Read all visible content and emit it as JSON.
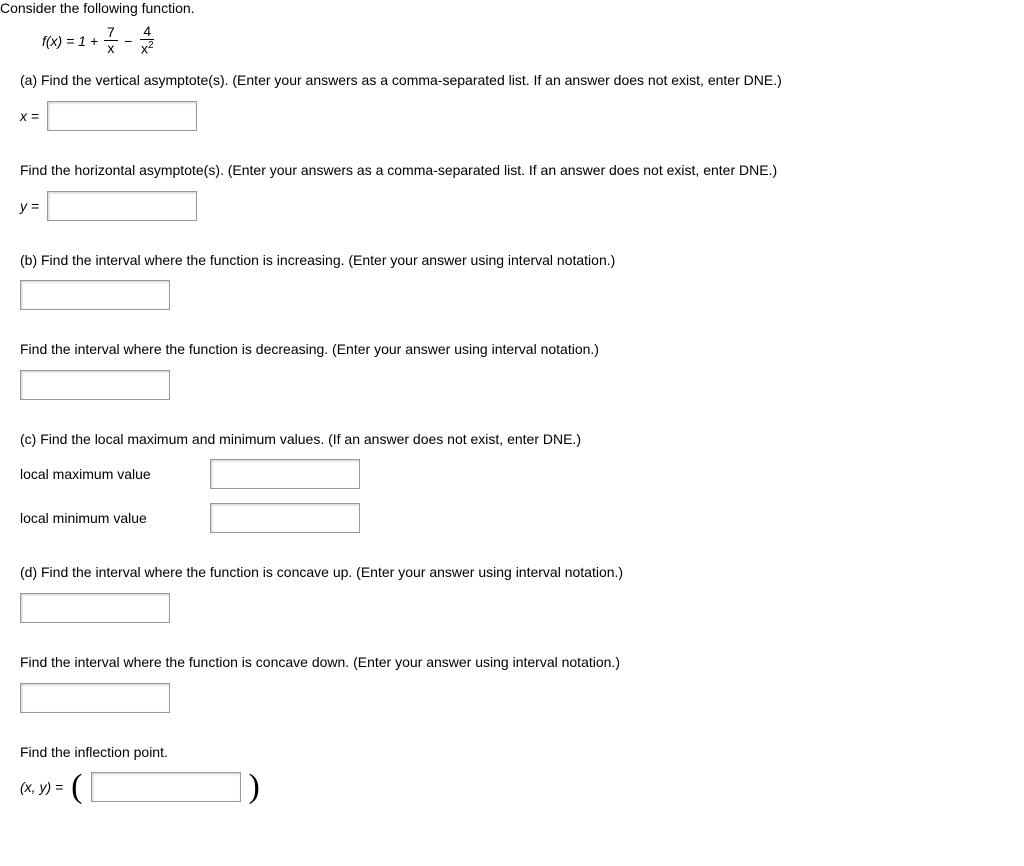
{
  "intro": "Consider the following function.",
  "formula": {
    "lhs": "f(x) = 1 +",
    "frac1_num": "7",
    "frac1_den": "x",
    "minus": "−",
    "frac2_num": "4",
    "frac2_den_base": "x",
    "frac2_den_exp": "2"
  },
  "parts": {
    "a_vert": "(a) Find the vertical asymptote(s). (Enter your answers as a comma-separated list. If an answer does not exist, enter DNE.)",
    "a_vert_label": "x =",
    "a_horiz": "Find the horizontal asymptote(s). (Enter your answers as a comma-separated list. If an answer does not exist, enter DNE.)",
    "a_horiz_label": "y =",
    "b_inc": "(b) Find the interval where the function is increasing. (Enter your answer using interval notation.)",
    "b_dec": "Find the interval where the function is decreasing. (Enter your answer using interval notation.)",
    "c": "(c) Find the local maximum and minimum values. (If an answer does not exist, enter DNE.)",
    "c_max_label": "local maximum value",
    "c_min_label": "local minimum value",
    "d_up": "(d) Find the interval where the function is concave up. (Enter your answer using interval notation.)",
    "d_down": "Find the interval where the function is concave down. (Enter your answer using interval notation.)",
    "inflect": "Find the inflection point.",
    "xy_label_open": "(x, y) = ",
    "paren_open": "(",
    "paren_close": ")"
  }
}
